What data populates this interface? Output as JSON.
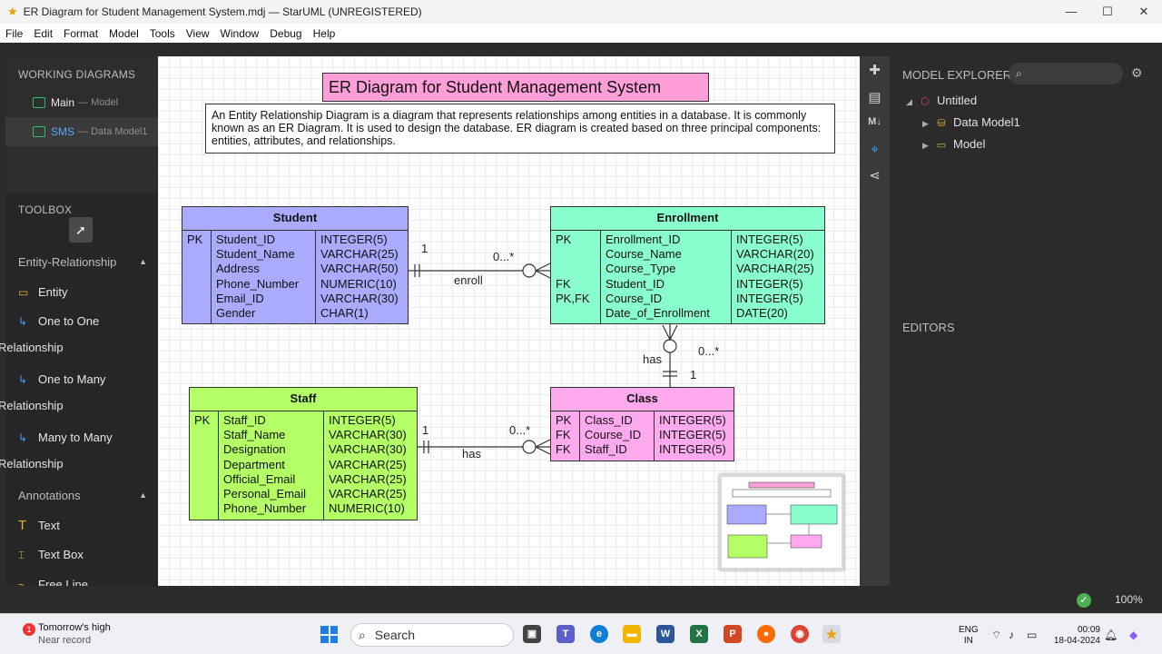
{
  "window": {
    "title": "ER Diagram for Student Management System.mdj — StarUML (UNREGISTERED)",
    "controls": [
      "—",
      "☐",
      "✕"
    ]
  },
  "menu": [
    "File",
    "Edit",
    "Format",
    "Model",
    "Tools",
    "View",
    "Window",
    "Debug",
    "Help"
  ],
  "working_diagrams": {
    "header": "WORKING DIAGRAMS",
    "items": [
      {
        "name": "Main",
        "sub": "— Model"
      },
      {
        "name": "SMS",
        "sub": "— Data Model1"
      }
    ]
  },
  "toolbox": {
    "header": "TOOLBOX",
    "groups": {
      "er": "Entity-Relationship",
      "annotations": "Annotations"
    },
    "er_tools": [
      {
        "label": "Entity",
        "icon": "entity-icon"
      },
      {
        "label": "One to One",
        "label2": "Relationship",
        "icon": "one-to-one-icon"
      },
      {
        "label": "One to Many",
        "label2": "Relationship",
        "icon": "one-to-many-icon"
      },
      {
        "label": "Many to Many",
        "label2": "Relationship",
        "icon": "many-to-many-icon"
      }
    ],
    "annotation_tools": [
      {
        "label": "Text",
        "icon": "text-icon"
      },
      {
        "label": "Text Box",
        "icon": "text-box-icon"
      },
      {
        "label": "Free Line",
        "icon": "free-line-icon"
      }
    ]
  },
  "diagram": {
    "title": "ER Diagram for Student Management System",
    "description": "An Entity Relationship Diagram is a diagram that represents relationships among entities in a database. It is commonly known as an ER Diagram. It is used to design the database. ER diagram is created based on three principal components: entities, attributes, and relationships.",
    "entities": {
      "student": {
        "name": "Student",
        "color": "#aaaaff",
        "keys": [
          "PK",
          "",
          "",
          "",
          "",
          ""
        ],
        "columns": [
          "Student_ID",
          "Student_Name",
          "Address",
          "Phone_Number",
          "Email_ID",
          "Gender"
        ],
        "types": [
          "INTEGER(5)",
          "VARCHAR(25)",
          "VARCHAR(50)",
          "NUMERIC(10)",
          "VARCHAR(30)",
          "CHAR(1)"
        ]
      },
      "enrollment": {
        "name": "Enrollment",
        "color": "#88ffcc",
        "keys": [
          "PK",
          "",
          "",
          "FK",
          "PK,FK",
          ""
        ],
        "columns": [
          "Enrollment_ID",
          "Course_Name",
          "Course_Type",
          "Student_ID",
          "Course_ID",
          "Date_of_Enrollment"
        ],
        "types": [
          "INTEGER(5)",
          "VARCHAR(20)",
          "VARCHAR(25)",
          "INTEGER(5)",
          "INTEGER(5)",
          "DATE(20)"
        ]
      },
      "staff": {
        "name": "Staff",
        "color": "#b4ff66",
        "keys": [
          "PK",
          "",
          "",
          "",
          "",
          "",
          ""
        ],
        "columns": [
          "Staff_ID",
          "Staff_Name",
          "Designation",
          "Department",
          "Official_Email",
          "Personal_Email",
          "Phone_Number"
        ],
        "types": [
          "INTEGER(5)",
          "VARCHAR(30)",
          "VARCHAR(30)",
          "VARCHAR(25)",
          "VARCHAR(25)",
          "VARCHAR(25)",
          "NUMERIC(10)"
        ]
      },
      "class": {
        "name": "Class",
        "color": "#ffaaee",
        "keys": [
          "PK",
          "FK",
          "FK"
        ],
        "columns": [
          "Class_ID",
          "Course_ID",
          "Staff_ID"
        ],
        "types": [
          "INTEGER(5)",
          "INTEGER(5)",
          "INTEGER(5)"
        ]
      }
    },
    "relationships": [
      {
        "name": "enroll",
        "one": "1",
        "many": "0...*"
      },
      {
        "name": "has",
        "one": "1",
        "many": "0...*"
      },
      {
        "name": "has",
        "one": "1",
        "many": "0...*"
      }
    ]
  },
  "model_explorer": {
    "header": "MODEL EXPLORER",
    "search_placeholder": "",
    "tree": [
      {
        "label": "Untitled",
        "icon": "project-icon"
      },
      {
        "label": "Data Model1",
        "icon": "data-model-icon"
      },
      {
        "label": "Model",
        "icon": "model-package-icon"
      }
    ]
  },
  "editors": {
    "header": "EDITORS"
  },
  "statusbar": {
    "zoom": "100%"
  },
  "taskbar": {
    "weather_title": "Tomorrow's high",
    "weather_sub": "Near record",
    "weather_badge": "1",
    "search": "Search",
    "lang1": "ENG",
    "lang2": "IN",
    "time": "00:09",
    "date": "18-04-2024"
  }
}
